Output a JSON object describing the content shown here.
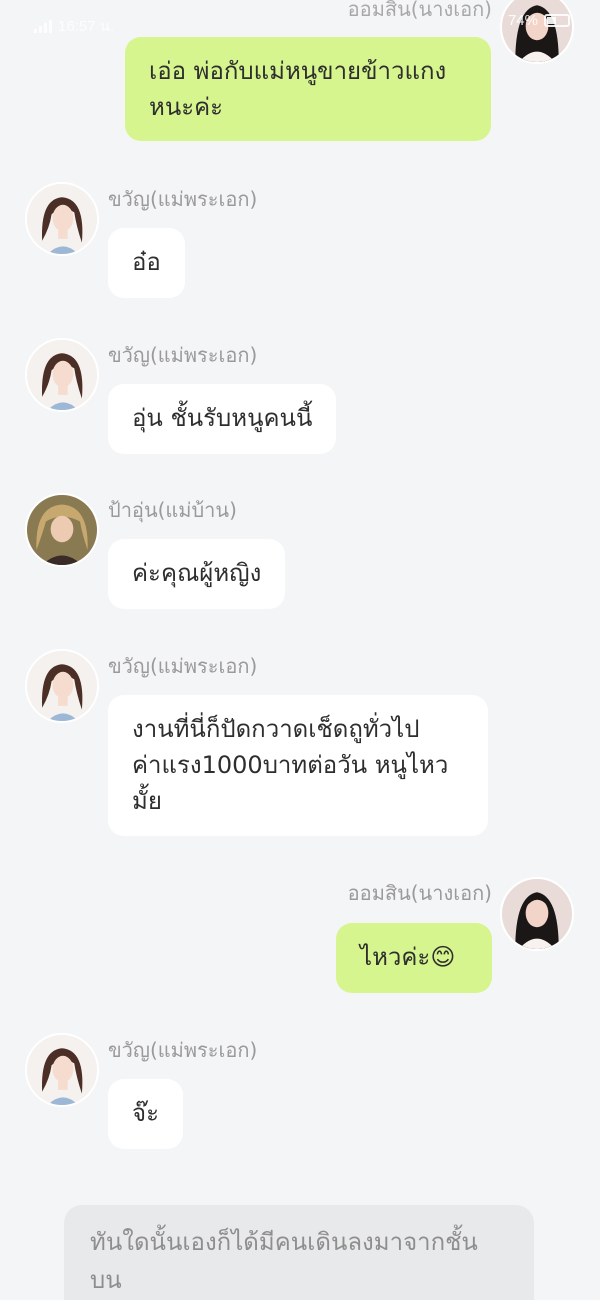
{
  "status_bar": {
    "time": "16:57 น.",
    "battery": "74%"
  },
  "characters": {
    "heroine": "ออมสิน(นางเอก)",
    "hero_mother": "ขวัญ(แม่พระเอก)",
    "maid": "ป้าอุ่น(แม่บ้าน)"
  },
  "messages": [
    {
      "text": "เอ่อ พ่อกับแม่หนูขายข้าวแกงหนะค่ะ"
    },
    {
      "text": "อ๋อ"
    },
    {
      "text": "อุ่น ชั้นรับหนูคนนี้"
    },
    {
      "text": "ค่ะคุณผู้หญิง"
    },
    {
      "text": "งานที่นี่ก็ปัดกวาดเช็ดถูทั่วไป ค่าแรง1000บาทต่อวัน หนูไหวมั้ย"
    },
    {
      "text": "ไหวค่ะ😊"
    },
    {
      "text": "จ๊ะ"
    }
  ],
  "narration": "ทันใดนั้นเองก็ได้มีคนเดินลงมาจากชั้นบน",
  "colors": {
    "background": "#f4f5f7",
    "bubble_self": "#d7f58e",
    "bubble_other": "#ffffff",
    "narration_bg": "#e8e9eb"
  },
  "icons": [
    "signal-icon",
    "battery-icon"
  ]
}
